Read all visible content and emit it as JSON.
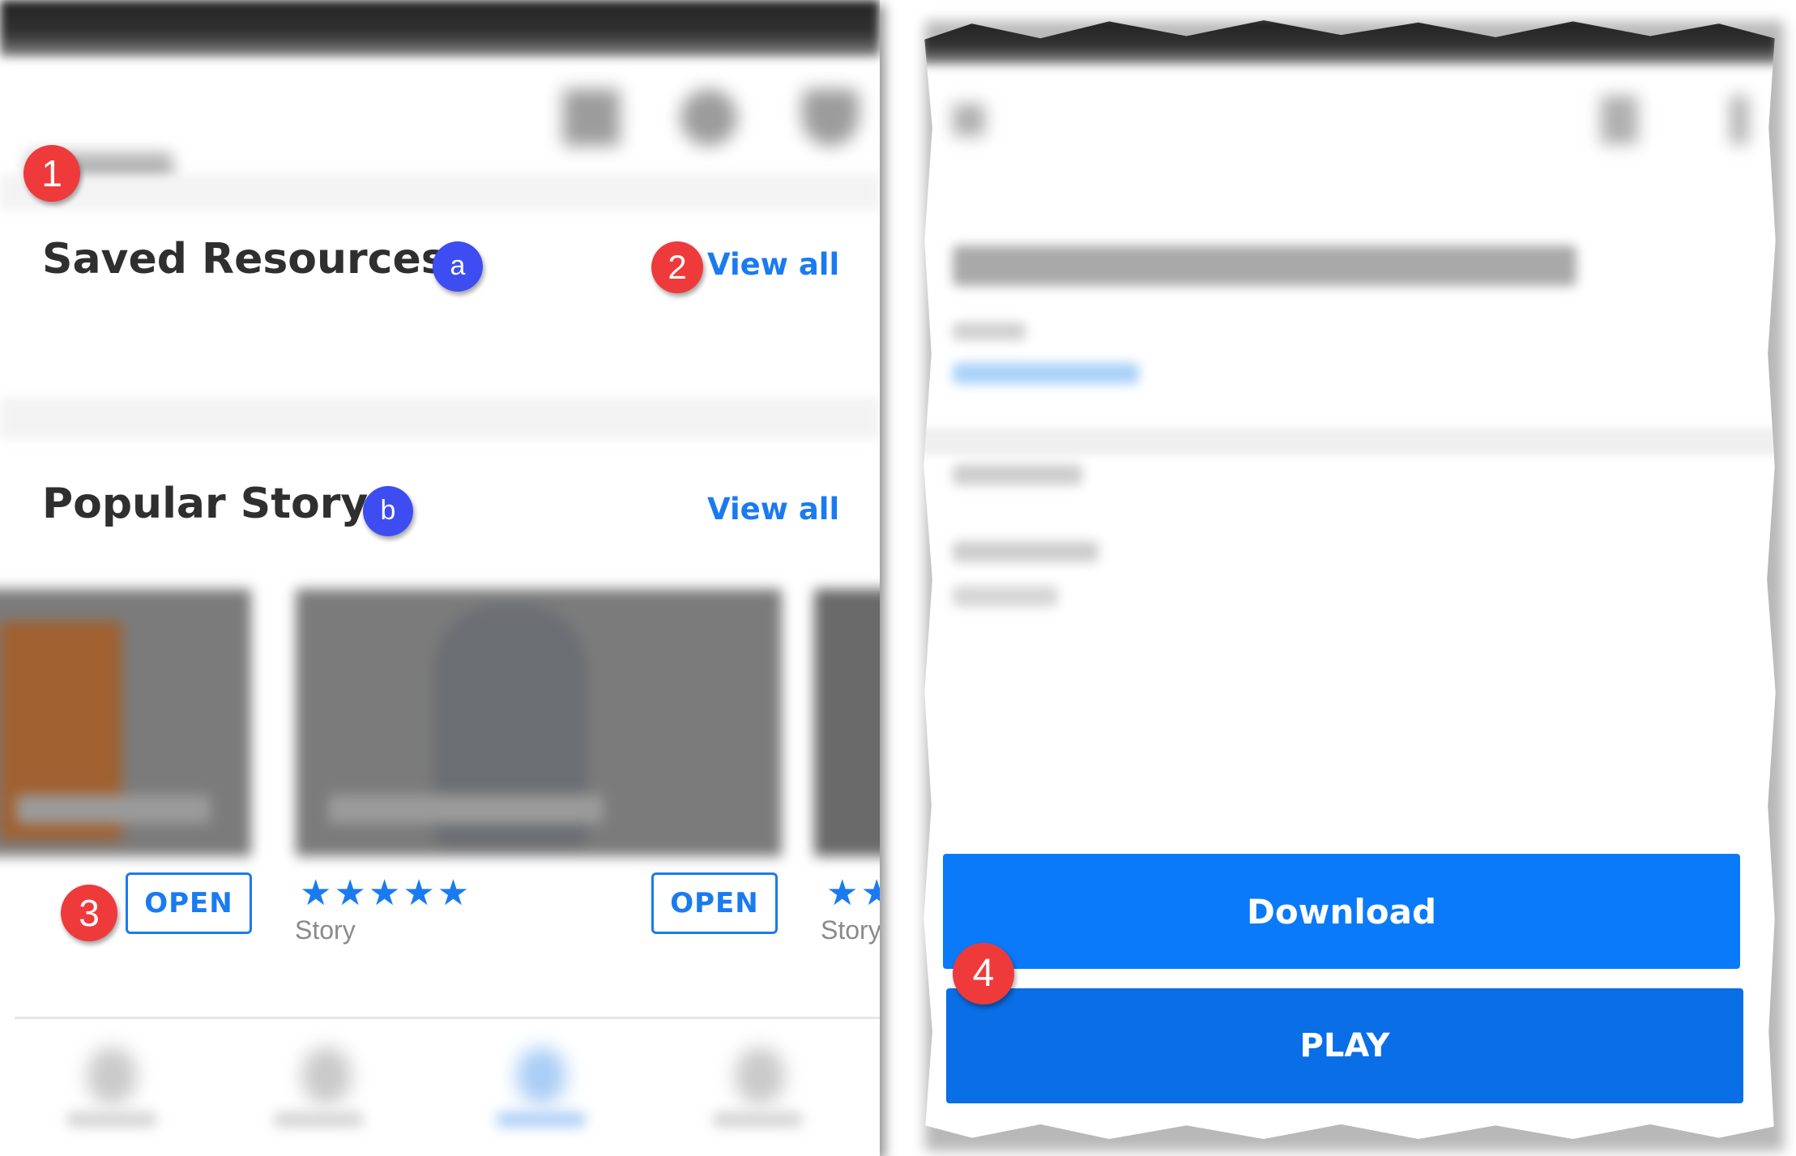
{
  "left_screen": {
    "saved_resources": {
      "title": "Saved Resources",
      "view_all": "View all",
      "badge": "a"
    },
    "popular_story": {
      "title": "Popular Story",
      "view_all": "View all",
      "badge": "b"
    },
    "cards": [
      {
        "button": "OPEN",
        "type": "Story",
        "rating": 5
      },
      {
        "button": "OPEN",
        "type": "Story",
        "rating": 5
      }
    ]
  },
  "right_screen": {
    "download_label": "Download",
    "play_label": "PLAY"
  },
  "callouts": {
    "c1": "1",
    "c2": "2",
    "c3": "3",
    "c4": "4"
  },
  "colors": {
    "accent": "#1a7bf0",
    "button_blue": "#0a7af8",
    "callout_red": "#ef3a3b",
    "callout_blue": "#3d4df1"
  },
  "icons": [
    "grid-icon",
    "search-icon",
    "filter-icon",
    "back-arrow-icon",
    "share-icon",
    "more-vert-icon",
    "star-icon"
  ]
}
